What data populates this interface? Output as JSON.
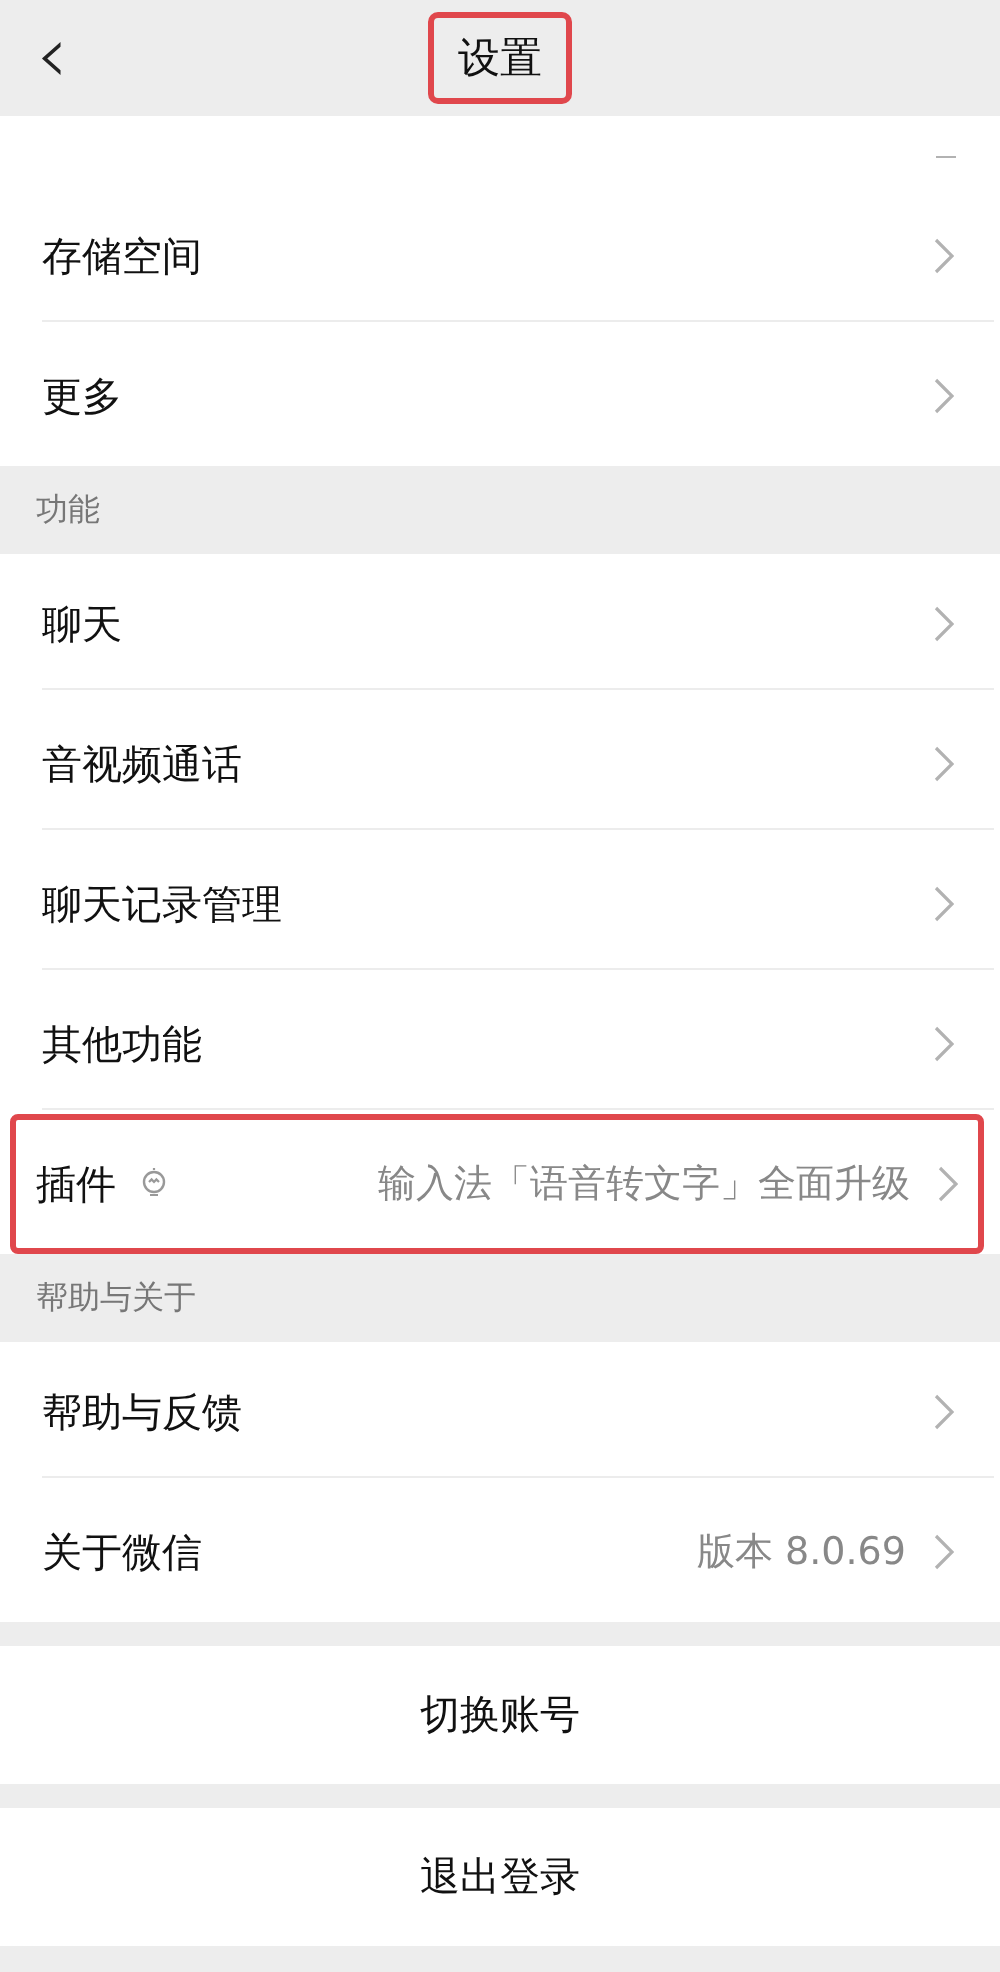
{
  "header": {
    "back_icon": "‹",
    "title": "设置",
    "highlighted": true
  },
  "groups": [
    {
      "items": [
        {
          "label": "存储空间",
          "highlighted": false
        },
        {
          "label": "更多",
          "highlighted": false
        }
      ]
    },
    {
      "title": "功能",
      "items": [
        {
          "label": "聊天",
          "highlighted": false
        },
        {
          "label": "音视频通话",
          "highlighted": false
        },
        {
          "label": "聊天记录管理",
          "highlighted": false
        },
        {
          "label": "其他功能",
          "highlighted": false
        },
        {
          "label": "插件",
          "badge": true,
          "detail": "输入法「语音转文字」全面升级",
          "highlighted": true
        }
      ]
    },
    {
      "title": "帮助与关于",
      "items": [
        {
          "label": "帮助与反馈",
          "highlighted": false
        },
        {
          "label": "关于微信",
          "detail": "版本 8.0.69",
          "highlighted": false
        }
      ]
    }
  ],
  "buttons": [
    "切换账号",
    "退出登录"
  ]
}
